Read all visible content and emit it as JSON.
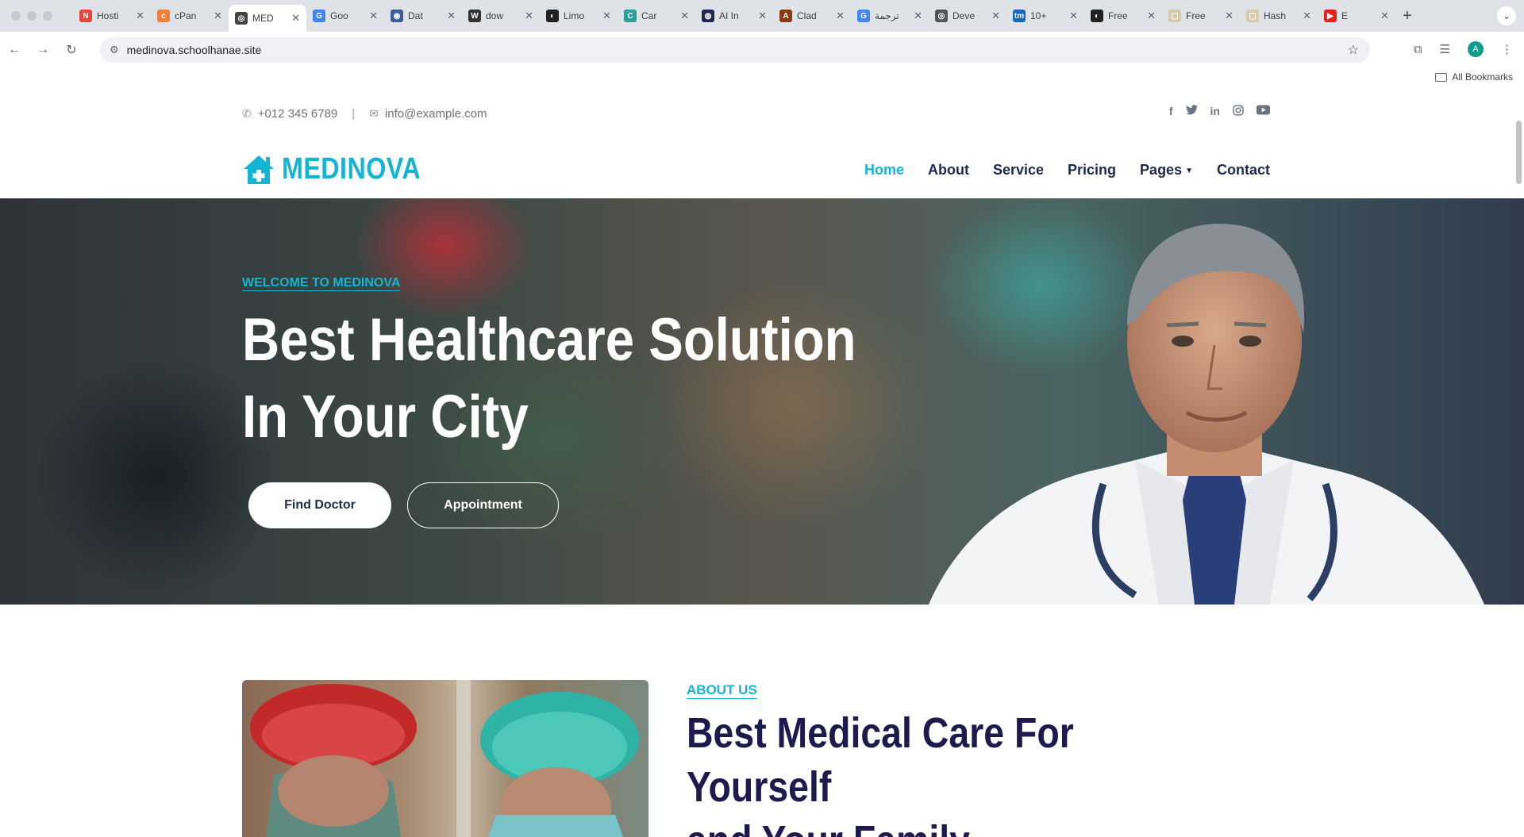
{
  "browser": {
    "tabs": [
      {
        "title": "Hosti",
        "color": "#e8453c",
        "glyph": "N"
      },
      {
        "title": "cPan",
        "color": "#f27e3a",
        "glyph": "c"
      },
      {
        "title": "MED",
        "color": "#444444",
        "glyph": "◎",
        "active": true
      },
      {
        "title": "Goo",
        "color": "#4285f4",
        "glyph": "G"
      },
      {
        "title": "Dat",
        "color": "#3b5b9a",
        "glyph": "◉"
      },
      {
        "title": "dow",
        "color": "#333333",
        "glyph": "W"
      },
      {
        "title": "Limo",
        "color": "#222222",
        "glyph": "◐"
      },
      {
        "title": "Car",
        "color": "#2aa198",
        "glyph": "C"
      },
      {
        "title": "AI In",
        "color": "#1d2a4d",
        "glyph": "◍"
      },
      {
        "title": "Clad",
        "color": "#8a3b12",
        "glyph": "A"
      },
      {
        "title": "ترجمة",
        "color": "#4285f4",
        "glyph": "G"
      },
      {
        "title": "Deve",
        "color": "#555555",
        "glyph": "◎"
      },
      {
        "title": "10+",
        "color": "#1565c0",
        "glyph": "tm"
      },
      {
        "title": "Free",
        "color": "#222222",
        "glyph": "◐"
      },
      {
        "title": "Free",
        "color": "#d8c9a8",
        "glyph": "▢"
      },
      {
        "title": "Hash",
        "color": "#d8c9a8",
        "glyph": "▢"
      },
      {
        "title": "E",
        "color": "#e62117",
        "glyph": "▶"
      }
    ],
    "url": "medinova.schoolhanae.site",
    "all_bookmarks": "All Bookmarks",
    "profile_initial": "A"
  },
  "topbar": {
    "phone": "+012 345 6789",
    "separator": "|",
    "email": "info@example.com",
    "socials": [
      "f",
      "t",
      "in",
      "ig",
      "yt"
    ]
  },
  "nav": {
    "logo": "MEDINOVA",
    "items": [
      "Home",
      "About",
      "Service",
      "Pricing",
      "Pages",
      "Contact"
    ],
    "active": "Home"
  },
  "hero": {
    "kicker": "WELCOME TO MEDINOVA",
    "title_line1": "Best Healthcare Solution",
    "title_line2": "In Your City",
    "btn_primary": "Find Doctor",
    "btn_secondary": "Appointment"
  },
  "about": {
    "kicker": "ABOUT US",
    "title_line1": "Best Medical Care For Yourself",
    "title_line2": "and Your Family"
  },
  "colors": {
    "brand": "#13b5d3",
    "navy": "#1d2a4d"
  }
}
